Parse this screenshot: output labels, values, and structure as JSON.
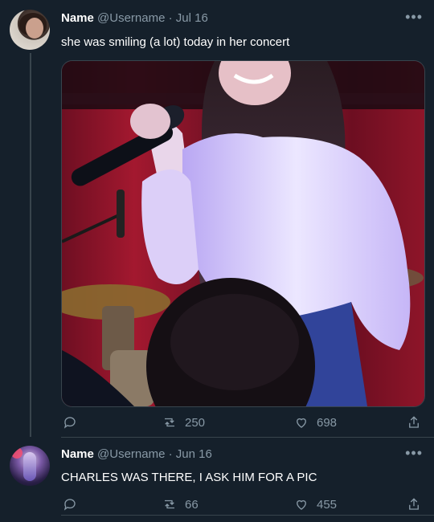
{
  "tweet1": {
    "name": "Name",
    "handle": "@Username",
    "separator": "·",
    "date": "Jul 16",
    "text": "she was smiling (a lot) today in her concert",
    "retweets": "250",
    "likes": "698"
  },
  "tweet2": {
    "name": "Name",
    "handle": "@Username",
    "separator": "·",
    "date": "Jun 16",
    "text": "CHARLES WAS THERE, I ASK HIM FOR A PIC",
    "retweets": "66",
    "likes": "455"
  },
  "more_icon": "more-horizontal-icon",
  "colors": {
    "background": "#15202b",
    "secondary_text": "#8899a6",
    "border": "#38444d"
  }
}
